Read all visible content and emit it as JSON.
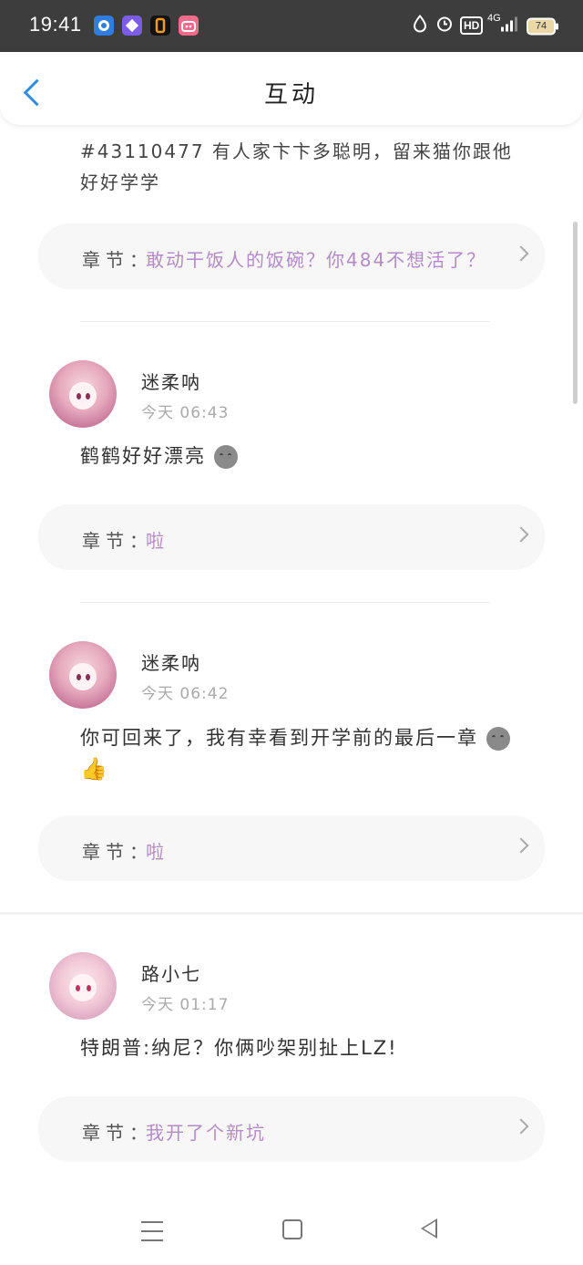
{
  "status_bar": {
    "time": "19:41",
    "app_icons": [
      "blue-circle-app-icon",
      "purple-app-icon",
      "orange-app-icon",
      "bilibili-icon"
    ],
    "right_icons": [
      "drop-icon",
      "alarm-icon",
      "hd-icon",
      "signal-4g-icon"
    ],
    "hd_label": "HD",
    "network_label": "4G",
    "battery": "74"
  },
  "header": {
    "title": "互动"
  },
  "top_snippet": {
    "text": "#43110477 有人家卞卞多聪明，留来猫你跟他好好学学",
    "chapter_label": "章节：",
    "chapter_value": "敢动干饭人的饭碗？你484不想活了？"
  },
  "comments": [
    {
      "username": "迷柔呐",
      "time": "今天 06:43",
      "text": "鹤鹤好好漂亮",
      "chapter_label": "章节：",
      "chapter_value": "啦"
    },
    {
      "username": "迷柔呐",
      "time": "今天 06:42",
      "text": "你可回来了，我有幸看到开学前的最后一章",
      "chapter_label": "章节：",
      "chapter_value": "啦"
    },
    {
      "username": "路小七",
      "time": "今天 01:17",
      "text": "特朗普:纳尼？你俩吵架别扯上LZ!",
      "chapter_label": "章节：",
      "chapter_value": "我开了个新坑"
    }
  ],
  "colors": {
    "accent": "#2e8fe0",
    "chapter_text": "#b48ac9",
    "status_bar": "#3d3d3d"
  }
}
